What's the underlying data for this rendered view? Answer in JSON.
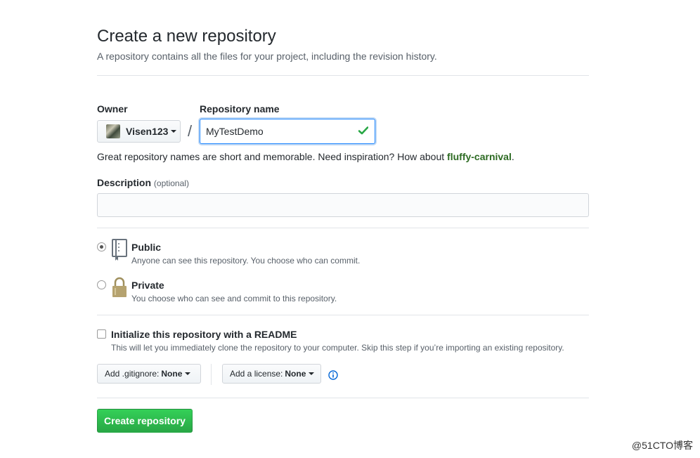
{
  "header": {
    "title": "Create a new repository",
    "subtitle": "A repository contains all the files for your project, including the revision history."
  },
  "owner": {
    "label": "Owner",
    "value": "Visen123"
  },
  "separator": "/",
  "repo_name": {
    "label": "Repository name",
    "value": "MyTestDemo"
  },
  "hint": {
    "prefix": "Great repository names are short and memorable. Need inspiration? How about ",
    "suggestion": "fluffy-carnival",
    "suffix": "."
  },
  "description": {
    "label": "Description",
    "optional": "(optional)",
    "value": ""
  },
  "visibility": {
    "public": {
      "title": "Public",
      "note": "Anyone can see this repository. You choose who can commit.",
      "icon": "repo-book-icon",
      "checked": true
    },
    "private": {
      "title": "Private",
      "note": "You choose who can see and commit to this repository.",
      "icon": "lock-icon",
      "checked": false
    }
  },
  "readme": {
    "label": "Initialize this repository with a README",
    "note": "This will let you immediately clone the repository to your computer. Skip this step if you’re importing an existing repository.",
    "checked": false
  },
  "gitignore": {
    "label": "Add .gitignore:",
    "value": "None"
  },
  "license": {
    "label": "Add a license:",
    "value": "None"
  },
  "create_button": "Create repository",
  "watermark": "@51CTO博客",
  "colors": {
    "accent_blue": "#2188ff",
    "success_green": "#28a745",
    "suggestion_green": "#2c6a22"
  }
}
